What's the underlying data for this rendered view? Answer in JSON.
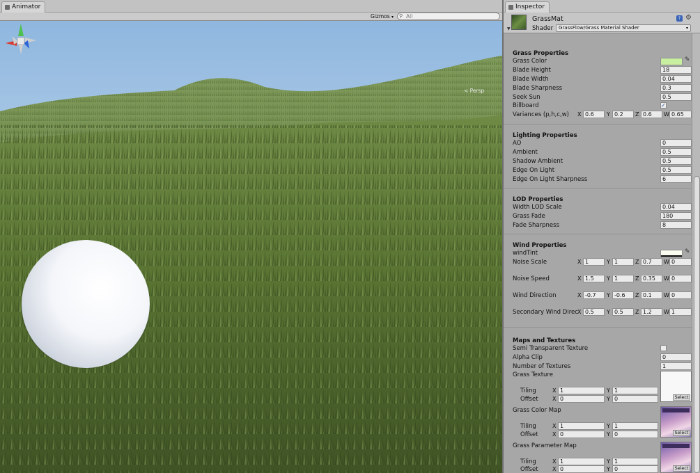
{
  "scene": {
    "tab_label": "Animator",
    "gizmos_label": "Gizmos",
    "search_placeholder": "All",
    "persp_label": "< Persp"
  },
  "inspector": {
    "tab_label": "Inspector",
    "material_name": "GrassMat",
    "shader_label": "Shader",
    "shader_value": "GrassFlow/Grass Material Shader"
  },
  "grass": {
    "title": "Grass Properties",
    "color_label": "Grass Color",
    "color": "#c8f0a0",
    "blade_height_label": "Blade Height",
    "blade_height": "18",
    "blade_width_label": "Blade Width",
    "blade_width": "0.04",
    "blade_sharpness_label": "Blade Sharpness",
    "blade_sharpness": "0.3",
    "seek_sun_label": "Seek Sun",
    "seek_sun": "0.5",
    "billboard_label": "Billboard",
    "billboard_checked": "✓",
    "variances_label": "Variances (p,h,c,w)",
    "variances": {
      "x": "0.6",
      "y": "0.2",
      "z": "0.6",
      "w": "0.65"
    }
  },
  "lighting": {
    "title": "Lighting Properties",
    "ao_label": "AO",
    "ao": "0",
    "ambient_label": "Ambient",
    "ambient": "0.5",
    "shadow_ambient_label": "Shadow Ambient",
    "shadow_ambient": "0.5",
    "edge_on_light_label": "Edge On Light",
    "edge_on_light": "0.5",
    "edge_sharpness_label": "Edge On Light Sharpness",
    "edge_sharpness": "6"
  },
  "lod": {
    "title": "LOD Properties",
    "width_lod_label": "Width LOD Scale",
    "width_lod": "0.04",
    "grass_fade_label": "Grass Fade",
    "grass_fade": "180",
    "fade_sharpness_label": "Fade Sharpness",
    "fade_sharpness": "8"
  },
  "wind": {
    "title": "Wind Properties",
    "tint_label": "windTint",
    "tint_color": "#fafcf0",
    "noise_scale_label": "Noise Scale",
    "noise_scale": {
      "x": "1",
      "y": "1",
      "z": "0.7",
      "w": "0"
    },
    "noise_speed_label": "Noise Speed",
    "noise_speed": {
      "x": "1.5",
      "y": "1",
      "z": "0.35",
      "w": "0"
    },
    "direction_label": "Wind Direction",
    "direction": {
      "x": "-0.7",
      "y": "-0.6",
      "z": "0.1",
      "w": "0"
    },
    "secondary_label": "Secondary Wind Direc",
    "secondary": {
      "x": "0.5",
      "y": "0.5",
      "z": "1.2",
      "w": "1"
    }
  },
  "maps": {
    "title": "Maps and Textures",
    "semi_transparent_label": "Semi Transparent Texture",
    "alpha_clip_label": "Alpha Clip",
    "alpha_clip": "0",
    "num_textures_label": "Number of Textures",
    "num_textures": "1",
    "grass_texture_label": "Grass Texture",
    "color_map_label": "Grass Color Map",
    "param_map_label": "Grass Parameter Map",
    "tiling_label": "Tiling",
    "offset_label": "Offset",
    "tiling": {
      "x": "1",
      "y": "1"
    },
    "offset": {
      "x": "0",
      "y": "0"
    },
    "select_label": "Select"
  },
  "axes": {
    "x": "X",
    "y": "Y",
    "z": "Z",
    "w": "W"
  }
}
